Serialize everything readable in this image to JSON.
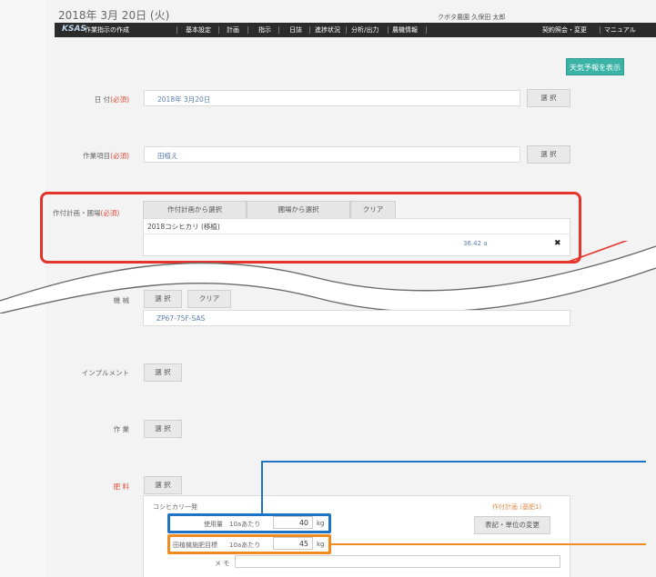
{
  "header": {
    "date": "2018年 3月 20日 (火)",
    "user": "クボタ農園  久保田  太郎"
  },
  "nav": {
    "logo": "KSAS",
    "page_title": "作業指示の作成",
    "items": [
      "基本設定",
      "計画",
      "指示",
      "日誌",
      "進捗状況",
      "分析/出力",
      "農機情報"
    ],
    "right_items": [
      "契約照会・変更",
      "マニュアル"
    ]
  },
  "weather_button": "天気予報を表示",
  "required_mark": "(必須)",
  "date_field": {
    "label": "日 付",
    "value": "2018年  3月20日",
    "button": "選 択"
  },
  "work_field": {
    "label": "作業項目",
    "value": "田植え",
    "button": "選 択"
  },
  "plan_field": {
    "label": "作付計画・圃場",
    "tabs": [
      "作付計画から選択",
      "圃場から選択",
      "クリア"
    ],
    "plan_name": "2018コシヒカリ (移植)",
    "area": "36.42 a",
    "remove_icon": "✖"
  },
  "machine_field": {
    "label": "機 械",
    "buttons": [
      "選 択",
      "クリア"
    ],
    "value": "ZP67-75F-SAS"
  },
  "implement_field": {
    "label": "インプルメント",
    "button": "選 択"
  },
  "worker_field": {
    "label": "作 業",
    "button": "選 択"
  },
  "fertilizer_field": {
    "label": "肥 料",
    "button": "選 択",
    "item_name": "コシヒカリ一発",
    "plan_tag": "作付計画 (基肥1)",
    "usage_label": "使用量",
    "per_label": "10aあたり",
    "usage_value": "40",
    "usage_unit": "kg",
    "target_label": "田植機施肥目標",
    "target_per_label": "10aあたり",
    "target_value": "45",
    "target_unit": "kg",
    "change_button": "表記・単位の変更",
    "memo_label": "メ モ"
  },
  "colors": {
    "navbar": "#2b2b2b",
    "accent_green": "#3bb3a7",
    "required_red": "#e04a3a",
    "highlight_red": "#e5352b",
    "highlight_blue": "#1f73c4",
    "highlight_orange": "#f08b1f"
  }
}
